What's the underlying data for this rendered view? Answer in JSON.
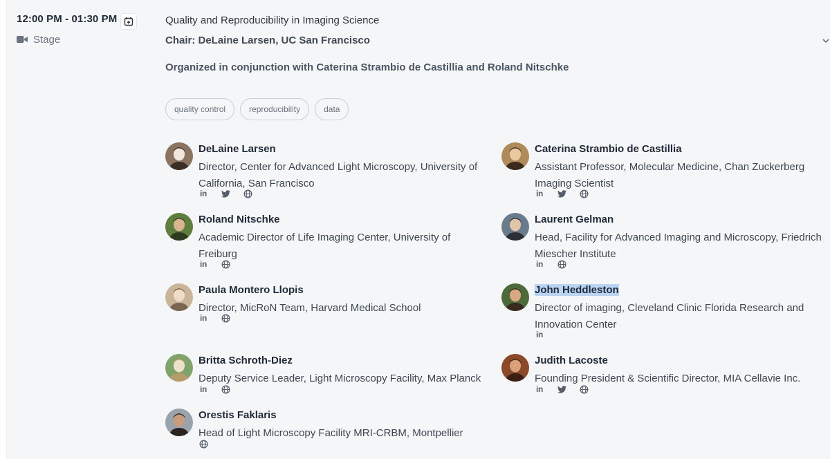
{
  "session": {
    "time": "12:00 PM - 01:30 PM",
    "location": "Stage",
    "location_icon": "video-camera-icon",
    "title": "Quality and Reproducibility in Imaging Science",
    "chair": "Chair: DeLaine Larsen, UC San Francisco",
    "organized": "Organized in conjunction with Caterina Strambio de Castillia and Roland Nitschke",
    "tags": [
      "quality control",
      "reproducibility",
      "data"
    ]
  },
  "speakers": [
    {
      "name": "DeLaine Larsen",
      "role": "Director, Center for Advanced Light Microscopy, University of California, San Francisco",
      "socials": [
        "linkedin",
        "twitter",
        "website"
      ],
      "highlighted": false,
      "avatar_colors": [
        "#8a7360",
        "#f1e6dc",
        "#3b2e25"
      ]
    },
    {
      "name": "Caterina Strambio de Castillia",
      "role": "Assistant Professor, Molecular Medicine, Chan Zuckerberg Imaging Scientist",
      "socials": [
        "linkedin",
        "twitter",
        "website"
      ],
      "highlighted": false,
      "avatar_colors": [
        "#b08a5a",
        "#e9c9a0",
        "#3a2b1c"
      ]
    },
    {
      "name": "Roland Nitschke",
      "role": "Academic Director of Life Imaging Center, University of Freiburg",
      "socials": [
        "linkedin",
        "website"
      ],
      "highlighted": false,
      "avatar_colors": [
        "#5f7d3d",
        "#d8b58f",
        "#2e3a1e"
      ]
    },
    {
      "name": "Laurent Gelman",
      "role": "Head, Facility for Advanced Imaging and Microscopy, Friedrich Miescher Institute",
      "socials": [
        "linkedin",
        "website"
      ],
      "highlighted": false,
      "avatar_colors": [
        "#6a7b8c",
        "#e2c4a8",
        "#2b2f35"
      ]
    },
    {
      "name": "Paula Montero Llopis",
      "role": "Director, MicRoN Team, Harvard Medical School",
      "socials": [
        "linkedin",
        "website"
      ],
      "highlighted": false,
      "avatar_colors": [
        "#c9b49a",
        "#f0dcc6",
        "#7a6550"
      ]
    },
    {
      "name": "John Heddleston",
      "role": "Director of imaging, Cleveland Clinic Florida Research and Innovation Center",
      "socials": [
        "linkedin"
      ],
      "highlighted": true,
      "avatar_colors": [
        "#4d6b3a",
        "#d9a882",
        "#3a2a1e"
      ]
    },
    {
      "name": "Britta Schroth-Diez",
      "role": "Deputy Service Leader, Light Microscopy Facility, Max Planck",
      "socials": [
        "linkedin",
        "website"
      ],
      "highlighted": false,
      "avatar_colors": [
        "#7fa36a",
        "#efe0c8",
        "#b89b6a"
      ]
    },
    {
      "name": "Judith Lacoste",
      "role": "Founding President & Scientific Director, MIA Cellavie Inc.",
      "socials": [
        "linkedin",
        "twitter",
        "website"
      ],
      "highlighted": false,
      "avatar_colors": [
        "#8a4a2a",
        "#d9a07a",
        "#3b1f12"
      ]
    },
    {
      "name": "Orestis Faklaris",
      "role": "Head of Light Microscopy Facility MRI-CRBM, Montpellier",
      "socials": [
        "website"
      ],
      "highlighted": false,
      "avatar_colors": [
        "#9aa3ab",
        "#c99a7c",
        "#2a2320"
      ]
    }
  ]
}
